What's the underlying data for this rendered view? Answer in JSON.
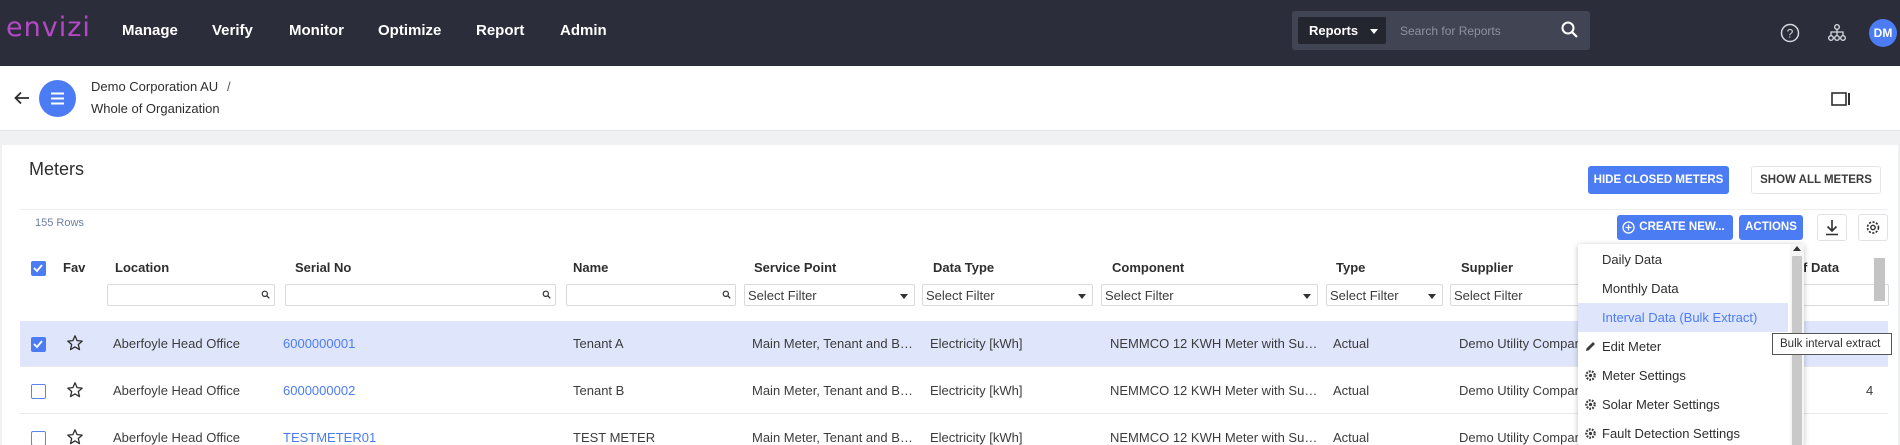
{
  "app": {
    "logo_text": "envizi",
    "accent": "#4c7cf3",
    "nav_bg": "#2b2d3a",
    "brand": "#b548c6"
  },
  "nav": {
    "items": [
      "Manage",
      "Verify",
      "Monitor",
      "Optimize",
      "Report",
      "Admin"
    ],
    "search_scope": "Reports",
    "search_placeholder": "Search for Reports",
    "icons": [
      "help-icon",
      "hierarchy-icon"
    ],
    "avatar": "DM"
  },
  "breadcrumb": {
    "org": "Demo Corporation AU",
    "separator": "/",
    "location": "Whole of Organization"
  },
  "page": {
    "title": "Meters",
    "hide_closed": "HIDE CLOSED METERS",
    "show_all": "SHOW ALL METERS",
    "row_count": "155 Rows",
    "create_new": "CREATE NEW...",
    "actions": "ACTIONS"
  },
  "table": {
    "columns": [
      "Fav",
      "Location",
      "Serial No",
      "Name",
      "Service Point",
      "Data Type",
      "Component",
      "Type",
      "Supplier",
      "f Data"
    ],
    "filter_placeholder": "Select Filter",
    "rows": [
      {
        "selected": true,
        "location": "Aberfoyle Head Office",
        "serial": "6000000001",
        "name": "Tenant A",
        "service_point": "Main Meter, Tenant and Bas...",
        "data_type": "Electricity [kWh]",
        "component": "NEMMCO 12 KWH Meter with Sub...",
        "type": "Actual",
        "supplier": "Demo Utility Compan",
        "last": ""
      },
      {
        "selected": false,
        "location": "Aberfoyle Head Office",
        "serial": "6000000002",
        "name": "Tenant B",
        "service_point": "Main Meter, Tenant and Bas...",
        "data_type": "Electricity [kWh]",
        "component": "NEMMCO 12 KWH Meter with Sub...",
        "type": "Actual",
        "supplier": "Demo Utility Compan",
        "last": "4"
      },
      {
        "selected": false,
        "location": "Aberfoyle Head Office",
        "serial": "TESTMETER01",
        "name": "TEST METER",
        "service_point": "Main Meter, Tenant and Bas...",
        "data_type": "Electricity [kWh]",
        "component": "NEMMCO 12 KWH Meter with Sub...",
        "type": "Actual",
        "supplier": "Demo Utility Compan",
        "last": ""
      }
    ]
  },
  "actions_menu": {
    "items": [
      {
        "label": "Daily Data",
        "icon": ""
      },
      {
        "label": "Monthly Data",
        "icon": ""
      },
      {
        "label": "Interval Data (Bulk Extract)",
        "icon": "",
        "highlighted": true
      },
      {
        "label": "Edit Meter",
        "icon": "pencil-icon"
      },
      {
        "label": "Meter Settings",
        "icon": "gear-icon"
      },
      {
        "label": "Solar Meter Settings",
        "icon": "gear-icon"
      },
      {
        "label": "Fault Detection Settings",
        "icon": "gear-icon"
      }
    ],
    "tooltip": "Bulk interval extract"
  }
}
